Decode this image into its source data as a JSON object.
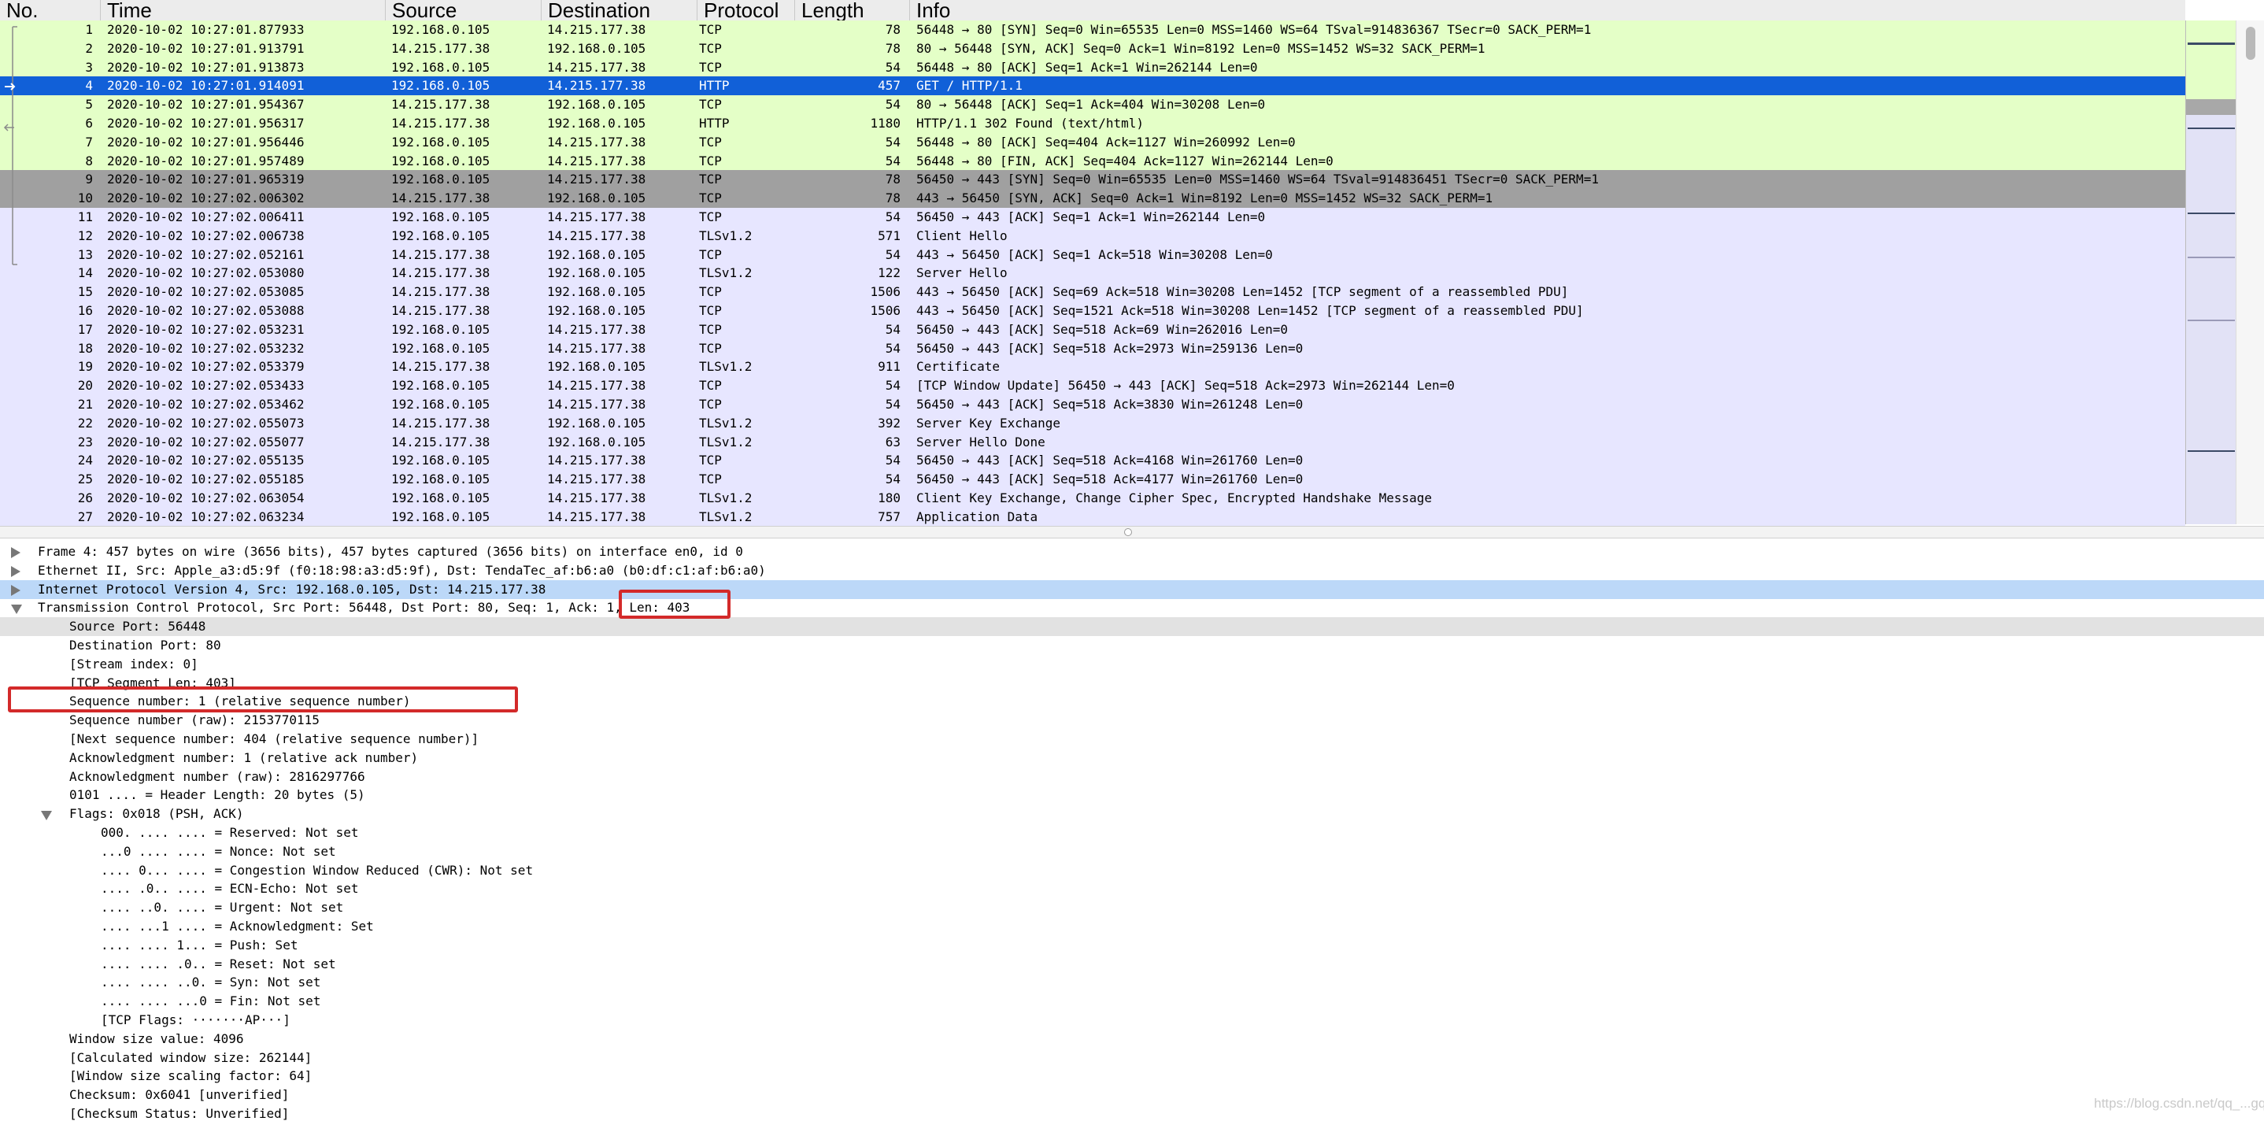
{
  "columns": {
    "no": "No.",
    "time": "Time",
    "source": "Source",
    "destination": "Destination",
    "protocol": "Protocol",
    "length": "Length",
    "info": "Info"
  },
  "colors": {
    "http_tcp": "#e4ffc7",
    "tls_tcp": "#e7e6ff",
    "syn_dark": "#a0a0a0",
    "selected": "#1160d8",
    "highlight": "#d32a2a"
  },
  "packets": [
    {
      "no": "1",
      "time": "2020-10-02 10:27:01.877933",
      "src": "192.168.0.105",
      "dst": "14.215.177.38",
      "proto": "TCP",
      "len": "78",
      "info": "56448 → 80 [SYN] Seq=0 Win=65535 Len=0 MSS=1460 WS=64 TSval=914836367 TSecr=0 SACK_PERM=1",
      "style": "green"
    },
    {
      "no": "2",
      "time": "2020-10-02 10:27:01.913791",
      "src": "14.215.177.38",
      "dst": "192.168.0.105",
      "proto": "TCP",
      "len": "78",
      "info": "80 → 56448 [SYN, ACK] Seq=0 Ack=1 Win=8192 Len=0 MSS=1452 WS=32 SACK_PERM=1",
      "style": "green"
    },
    {
      "no": "3",
      "time": "2020-10-02 10:27:01.913873",
      "src": "192.168.0.105",
      "dst": "14.215.177.38",
      "proto": "TCP",
      "len": "54",
      "info": "56448 → 80 [ACK] Seq=1 Ack=1 Win=262144 Len=0",
      "style": "green"
    },
    {
      "no": "4",
      "time": "2020-10-02 10:27:01.914091",
      "src": "192.168.0.105",
      "dst": "14.215.177.38",
      "proto": "HTTP",
      "len": "457",
      "info": "GET / HTTP/1.1",
      "style": "selected"
    },
    {
      "no": "5",
      "time": "2020-10-02 10:27:01.954367",
      "src": "14.215.177.38",
      "dst": "192.168.0.105",
      "proto": "TCP",
      "len": "54",
      "info": "80 → 56448 [ACK] Seq=1 Ack=404 Win=30208 Len=0",
      "style": "green"
    },
    {
      "no": "6",
      "time": "2020-10-02 10:27:01.956317",
      "src": "14.215.177.38",
      "dst": "192.168.0.105",
      "proto": "HTTP",
      "len": "1180",
      "info": "HTTP/1.1 302 Found  (text/html)",
      "style": "green"
    },
    {
      "no": "7",
      "time": "2020-10-02 10:27:01.956446",
      "src": "192.168.0.105",
      "dst": "14.215.177.38",
      "proto": "TCP",
      "len": "54",
      "info": "56448 → 80 [ACK] Seq=404 Ack=1127 Win=260992 Len=0",
      "style": "green"
    },
    {
      "no": "8",
      "time": "2020-10-02 10:27:01.957489",
      "src": "192.168.0.105",
      "dst": "14.215.177.38",
      "proto": "TCP",
      "len": "54",
      "info": "56448 → 80 [FIN, ACK] Seq=404 Ack=1127 Win=262144 Len=0",
      "style": "green"
    },
    {
      "no": "9",
      "time": "2020-10-02 10:27:01.965319",
      "src": "192.168.0.105",
      "dst": "14.215.177.38",
      "proto": "TCP",
      "len": "78",
      "info": "56450 → 443 [SYN] Seq=0 Win=65535 Len=0 MSS=1460 WS=64 TSval=914836451 TSecr=0 SACK_PERM=1",
      "style": "dark"
    },
    {
      "no": "10",
      "time": "2020-10-02 10:27:02.006302",
      "src": "14.215.177.38",
      "dst": "192.168.0.105",
      "proto": "TCP",
      "len": "78",
      "info": "443 → 56450 [SYN, ACK] Seq=0 Ack=1 Win=8192 Len=0 MSS=1452 WS=32 SACK_PERM=1",
      "style": "dark"
    },
    {
      "no": "11",
      "time": "2020-10-02 10:27:02.006411",
      "src": "192.168.0.105",
      "dst": "14.215.177.38",
      "proto": "TCP",
      "len": "54",
      "info": "56450 → 443 [ACK] Seq=1 Ack=1 Win=262144 Len=0",
      "style": "lavender"
    },
    {
      "no": "12",
      "time": "2020-10-02 10:27:02.006738",
      "src": "192.168.0.105",
      "dst": "14.215.177.38",
      "proto": "TLSv1.2",
      "len": "571",
      "info": "Client Hello",
      "style": "lavender"
    },
    {
      "no": "13",
      "time": "2020-10-02 10:27:02.052161",
      "src": "14.215.177.38",
      "dst": "192.168.0.105",
      "proto": "TCP",
      "len": "54",
      "info": "443 → 56450 [ACK] Seq=1 Ack=518 Win=30208 Len=0",
      "style": "lavender"
    },
    {
      "no": "14",
      "time": "2020-10-02 10:27:02.053080",
      "src": "14.215.177.38",
      "dst": "192.168.0.105",
      "proto": "TLSv1.2",
      "len": "122",
      "info": "Server Hello",
      "style": "lavender"
    },
    {
      "no": "15",
      "time": "2020-10-02 10:27:02.053085",
      "src": "14.215.177.38",
      "dst": "192.168.0.105",
      "proto": "TCP",
      "len": "1506",
      "info": "443 → 56450 [ACK] Seq=69 Ack=518 Win=30208 Len=1452 [TCP segment of a reassembled PDU]",
      "style": "lavender"
    },
    {
      "no": "16",
      "time": "2020-10-02 10:27:02.053088",
      "src": "14.215.177.38",
      "dst": "192.168.0.105",
      "proto": "TCP",
      "len": "1506",
      "info": "443 → 56450 [ACK] Seq=1521 Ack=518 Win=30208 Len=1452 [TCP segment of a reassembled PDU]",
      "style": "lavender"
    },
    {
      "no": "17",
      "time": "2020-10-02 10:27:02.053231",
      "src": "192.168.0.105",
      "dst": "14.215.177.38",
      "proto": "TCP",
      "len": "54",
      "info": "56450 → 443 [ACK] Seq=518 Ack=69 Win=262016 Len=0",
      "style": "lavender"
    },
    {
      "no": "18",
      "time": "2020-10-02 10:27:02.053232",
      "src": "192.168.0.105",
      "dst": "14.215.177.38",
      "proto": "TCP",
      "len": "54",
      "info": "56450 → 443 [ACK] Seq=518 Ack=2973 Win=259136 Len=0",
      "style": "lavender"
    },
    {
      "no": "19",
      "time": "2020-10-02 10:27:02.053379",
      "src": "14.215.177.38",
      "dst": "192.168.0.105",
      "proto": "TLSv1.2",
      "len": "911",
      "info": "Certificate",
      "style": "lavender"
    },
    {
      "no": "20",
      "time": "2020-10-02 10:27:02.053433",
      "src": "192.168.0.105",
      "dst": "14.215.177.38",
      "proto": "TCP",
      "len": "54",
      "info": "[TCP Window Update] 56450 → 443 [ACK] Seq=518 Ack=2973 Win=262144 Len=0",
      "style": "lavender"
    },
    {
      "no": "21",
      "time": "2020-10-02 10:27:02.053462",
      "src": "192.168.0.105",
      "dst": "14.215.177.38",
      "proto": "TCP",
      "len": "54",
      "info": "56450 → 443 [ACK] Seq=518 Ack=3830 Win=261248 Len=0",
      "style": "lavender"
    },
    {
      "no": "22",
      "time": "2020-10-02 10:27:02.055073",
      "src": "14.215.177.38",
      "dst": "192.168.0.105",
      "proto": "TLSv1.2",
      "len": "392",
      "info": "Server Key Exchange",
      "style": "lavender"
    },
    {
      "no": "23",
      "time": "2020-10-02 10:27:02.055077",
      "src": "14.215.177.38",
      "dst": "192.168.0.105",
      "proto": "TLSv1.2",
      "len": "63",
      "info": "Server Hello Done",
      "style": "lavender"
    },
    {
      "no": "24",
      "time": "2020-10-02 10:27:02.055135",
      "src": "192.168.0.105",
      "dst": "14.215.177.38",
      "proto": "TCP",
      "len": "54",
      "info": "56450 → 443 [ACK] Seq=518 Ack=4168 Win=261760 Len=0",
      "style": "lavender"
    },
    {
      "no": "25",
      "time": "2020-10-02 10:27:02.055185",
      "src": "192.168.0.105",
      "dst": "14.215.177.38",
      "proto": "TCP",
      "len": "54",
      "info": "56450 → 443 [ACK] Seq=518 Ack=4177 Win=261760 Len=0",
      "style": "lavender"
    },
    {
      "no": "26",
      "time": "2020-10-02 10:27:02.063054",
      "src": "192.168.0.105",
      "dst": "14.215.177.38",
      "proto": "TLSv1.2",
      "len": "180",
      "info": "Client Key Exchange, Change Cipher Spec, Encrypted Handshake Message",
      "style": "lavender"
    },
    {
      "no": "27",
      "time": "2020-10-02 10:27:02.063234",
      "src": "192.168.0.105",
      "dst": "14.215.177.38",
      "proto": "TLSv1.2",
      "len": "757",
      "info": "Application Data",
      "style": "lavender"
    }
  ],
  "details": [
    {
      "level": 0,
      "expand": "collapsed",
      "text": "Frame 4: 457 bytes on wire (3656 bits), 457 bytes captured (3656 bits) on interface en0, id 0",
      "hl": ""
    },
    {
      "level": 0,
      "expand": "collapsed",
      "text": "Ethernet II, Src: Apple_a3:d5:9f (f0:18:98:a3:d5:9f), Dst: TendaTec_af:b6:a0 (b0:df:c1:af:b6:a0)",
      "hl": ""
    },
    {
      "level": 0,
      "expand": "collapsed",
      "text": "Internet Protocol Version 4, Src: 192.168.0.105, Dst: 14.215.177.38",
      "hl": "blue"
    },
    {
      "level": 0,
      "expand": "expanded",
      "text": "Transmission Control Protocol, Src Port: 56448, Dst Port: 80, Seq: 1, Ack: 1, Len: 403",
      "hl": ""
    },
    {
      "level": 1,
      "expand": "",
      "text": "Source Port: 56448",
      "hl": "gray"
    },
    {
      "level": 1,
      "expand": "",
      "text": "Destination Port: 80",
      "hl": ""
    },
    {
      "level": 1,
      "expand": "",
      "text": "[Stream index: 0]",
      "hl": ""
    },
    {
      "level": 1,
      "expand": "",
      "text": "[TCP Segment Len: 403]",
      "hl": ""
    },
    {
      "level": 1,
      "expand": "",
      "text": "Sequence number: 1    (relative sequence number)",
      "hl": ""
    },
    {
      "level": 1,
      "expand": "",
      "text": "Sequence number (raw): 2153770115",
      "hl": ""
    },
    {
      "level": 1,
      "expand": "",
      "text": "[Next sequence number: 404    (relative sequence number)]",
      "hl": ""
    },
    {
      "level": 1,
      "expand": "",
      "text": "Acknowledgment number: 1    (relative ack number)",
      "hl": ""
    },
    {
      "level": 1,
      "expand": "",
      "text": "Acknowledgment number (raw): 2816297766",
      "hl": ""
    },
    {
      "level": 1,
      "expand": "",
      "text": "0101 .... = Header Length: 20 bytes (5)",
      "hl": ""
    },
    {
      "level": 1,
      "expand": "expanded",
      "text": "Flags: 0x018 (PSH, ACK)",
      "hl": ""
    },
    {
      "level": 2,
      "expand": "",
      "text": "000. .... .... = Reserved: Not set",
      "hl": ""
    },
    {
      "level": 2,
      "expand": "",
      "text": "...0 .... .... = Nonce: Not set",
      "hl": ""
    },
    {
      "level": 2,
      "expand": "",
      "text": ".... 0... .... = Congestion Window Reduced (CWR): Not set",
      "hl": ""
    },
    {
      "level": 2,
      "expand": "",
      "text": ".... .0.. .... = ECN-Echo: Not set",
      "hl": ""
    },
    {
      "level": 2,
      "expand": "",
      "text": ".... ..0. .... = Urgent: Not set",
      "hl": ""
    },
    {
      "level": 2,
      "expand": "",
      "text": ".... ...1 .... = Acknowledgment: Set",
      "hl": ""
    },
    {
      "level": 2,
      "expand": "",
      "text": ".... .... 1... = Push: Set",
      "hl": ""
    },
    {
      "level": 2,
      "expand": "",
      "text": ".... .... .0.. = Reset: Not set",
      "hl": ""
    },
    {
      "level": 2,
      "expand": "",
      "text": ".... .... ..0. = Syn: Not set",
      "hl": ""
    },
    {
      "level": 2,
      "expand": "",
      "text": ".... .... ...0 = Fin: Not set",
      "hl": ""
    },
    {
      "level": 2,
      "expand": "",
      "text": "[TCP Flags: ·······AP···]",
      "hl": ""
    },
    {
      "level": 1,
      "expand": "",
      "text": "Window size value: 4096",
      "hl": ""
    },
    {
      "level": 1,
      "expand": "",
      "text": "[Calculated window size: 262144]",
      "hl": ""
    },
    {
      "level": 1,
      "expand": "",
      "text": "[Window size scaling factor: 64]",
      "hl": ""
    },
    {
      "level": 1,
      "expand": "",
      "text": "Checksum: 0x6041 [unverified]",
      "hl": ""
    },
    {
      "level": 1,
      "expand": "",
      "text": "[Checksum Status: Unverified]",
      "hl": ""
    }
  ],
  "watermark": "https://blog.csdn.net/qq_...gqxqin"
}
